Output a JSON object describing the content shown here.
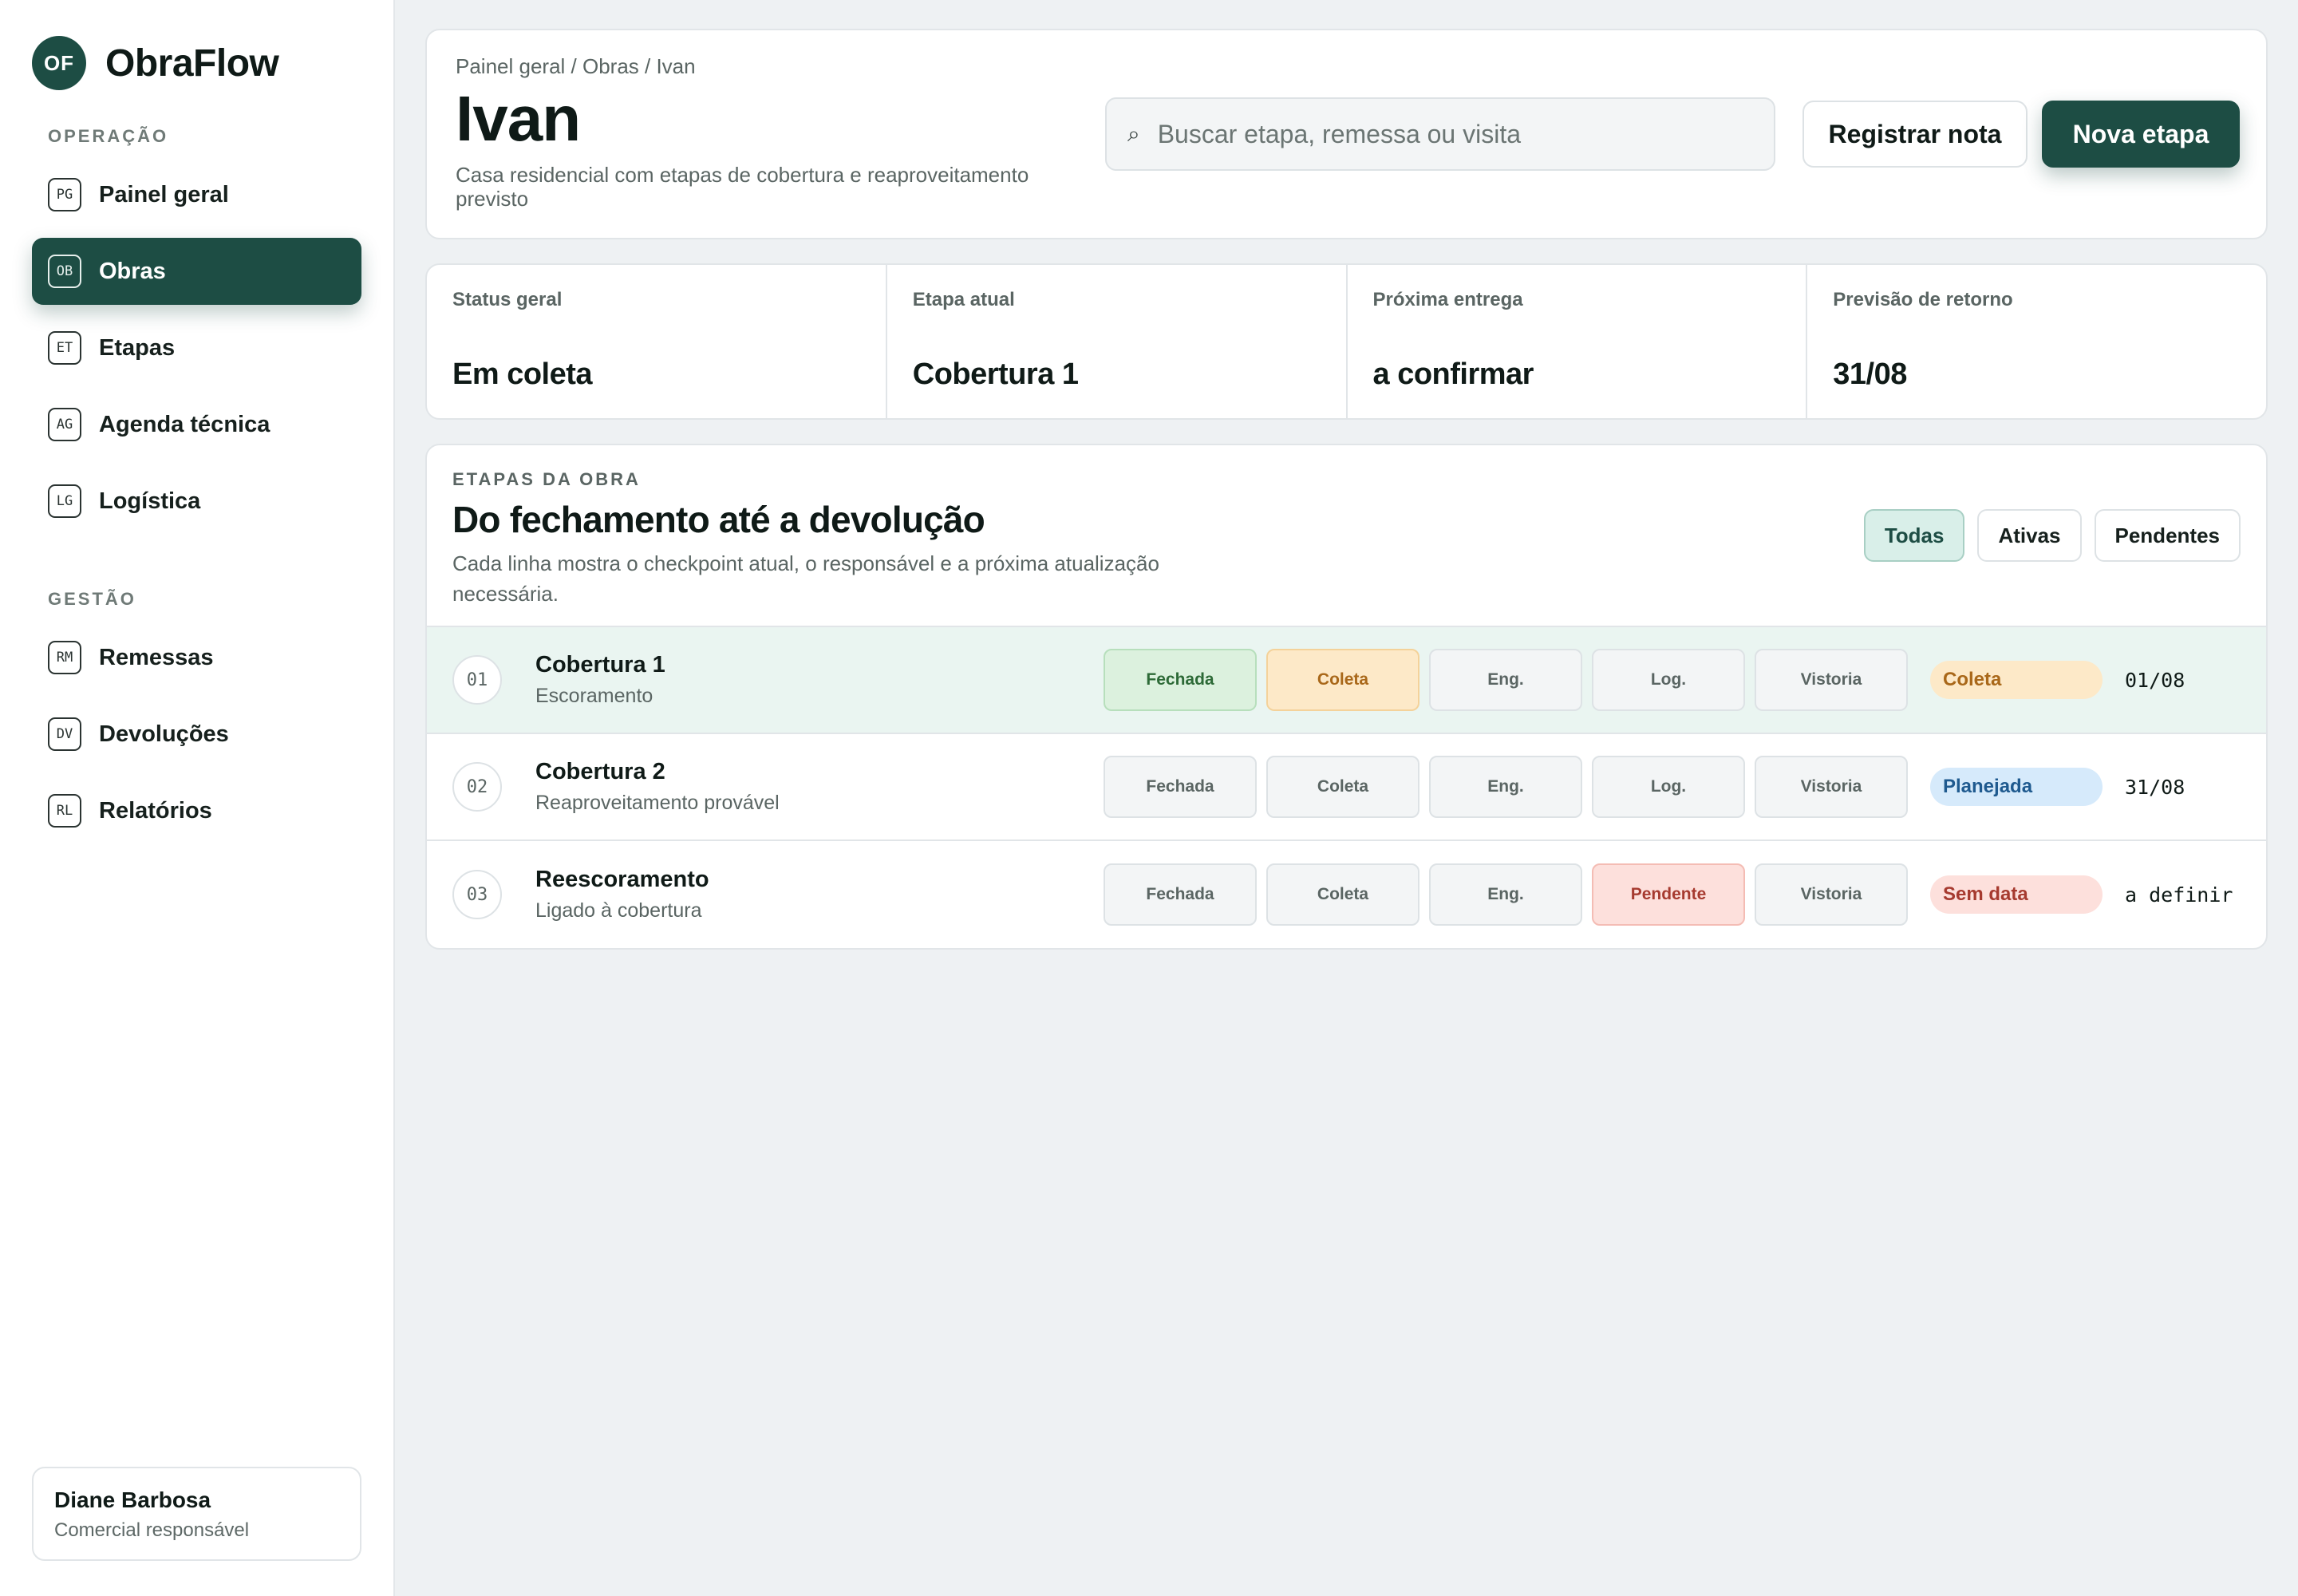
{
  "brand": {
    "logo": "OF",
    "name": "ObraFlow"
  },
  "sidebar": {
    "section_operacao": "OPERAÇÃO",
    "section_gestao": "GESTÃO",
    "items": [
      {
        "abbr": "PG",
        "label": "Painel geral"
      },
      {
        "abbr": "OB",
        "label": "Obras"
      },
      {
        "abbr": "ET",
        "label": "Etapas"
      },
      {
        "abbr": "AG",
        "label": "Agenda técnica"
      },
      {
        "abbr": "LG",
        "label": "Logística"
      },
      {
        "abbr": "RM",
        "label": "Remessas"
      },
      {
        "abbr": "DV",
        "label": "Devoluções"
      },
      {
        "abbr": "RL",
        "label": "Relatórios"
      }
    ],
    "active_item": "Obras",
    "user": {
      "name": "Diane Barbosa",
      "role": "Comercial responsável"
    }
  },
  "header": {
    "breadcrumb": "Painel geral / Obras / Ivan",
    "title": "Ivan",
    "description": "Casa residencial com etapas de cobertura e reaproveitamento previsto",
    "search_placeholder": "Buscar etapa, remessa ou visita",
    "search_icon": "search-icon",
    "btn_note": "Registrar nota",
    "btn_new": "Nova etapa"
  },
  "stats": [
    {
      "label": "Status geral",
      "value": "Em coleta"
    },
    {
      "label": "Etapa atual",
      "value": "Cobertura 1"
    },
    {
      "label": "Próxima entrega",
      "value": "a confirmar"
    },
    {
      "label": "Previsão de retorno",
      "value": "31/08"
    }
  ],
  "stages": {
    "kicker": "ETAPAS DA OBRA",
    "title": "Do fechamento até a devolução",
    "description": "Cada linha mostra o checkpoint atual, o responsável e a próxima atualização necessária.",
    "filters": [
      "Todas",
      "Ativas",
      "Pendentes"
    ],
    "active_filter": "Todas",
    "rows": [
      {
        "num": "01",
        "name": "Cobertura 1",
        "sub": "Escoramento",
        "checkpoints": [
          "Fechada",
          "Coleta",
          "Eng.",
          "Log.",
          "Vistoria"
        ],
        "status": "Coleta",
        "date": "01/08"
      },
      {
        "num": "02",
        "name": "Cobertura 2",
        "sub": "Reaproveitamento provável",
        "checkpoints": [
          "Fechada",
          "Coleta",
          "Eng.",
          "Log.",
          "Vistoria"
        ],
        "status": "Planejada",
        "date": "31/08"
      },
      {
        "num": "03",
        "name": "Reescoramento",
        "sub": "Ligado à cobertura",
        "checkpoints": [
          "Fechada",
          "Coleta",
          "Eng.",
          "Pendente",
          "Vistoria"
        ],
        "status": "Sem data",
        "date": "a definir"
      }
    ]
  },
  "colors": {
    "brand": "#1d4d44",
    "done": "#dcf1de",
    "current": "#fde9c8",
    "pending": "#fde0dc",
    "planned": "#d6eafb"
  }
}
